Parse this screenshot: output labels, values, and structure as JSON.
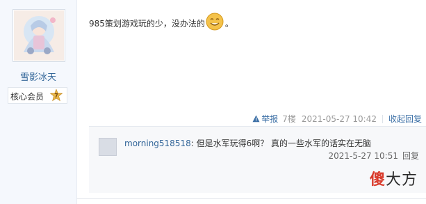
{
  "author": {
    "username": "雪影冰天",
    "rank_label": "核心会员",
    "rank_level": "7"
  },
  "post": {
    "text": "985策划游戏玩的少，没办法的",
    "after_emoji": "。",
    "report_label": "举报",
    "floor": "7楼",
    "time": "2021-05-27 10:42",
    "collapse_label": "收起回复"
  },
  "reply": {
    "user": "morning518518",
    "colon": ": ",
    "content": "但是水军玩得6啊？ 真的一些水军的话实在无脑",
    "time": "2021-5-27 10:51",
    "action": "回复"
  },
  "watermark": {
    "part1": "傻",
    "part2": "大方"
  },
  "colors": {
    "link": "#3a6ea5",
    "username": "#336699",
    "sidebar_bg": "#f5f8fd",
    "badge_gold": "#e9b84a",
    "watermark_red": "#d93a2b"
  }
}
